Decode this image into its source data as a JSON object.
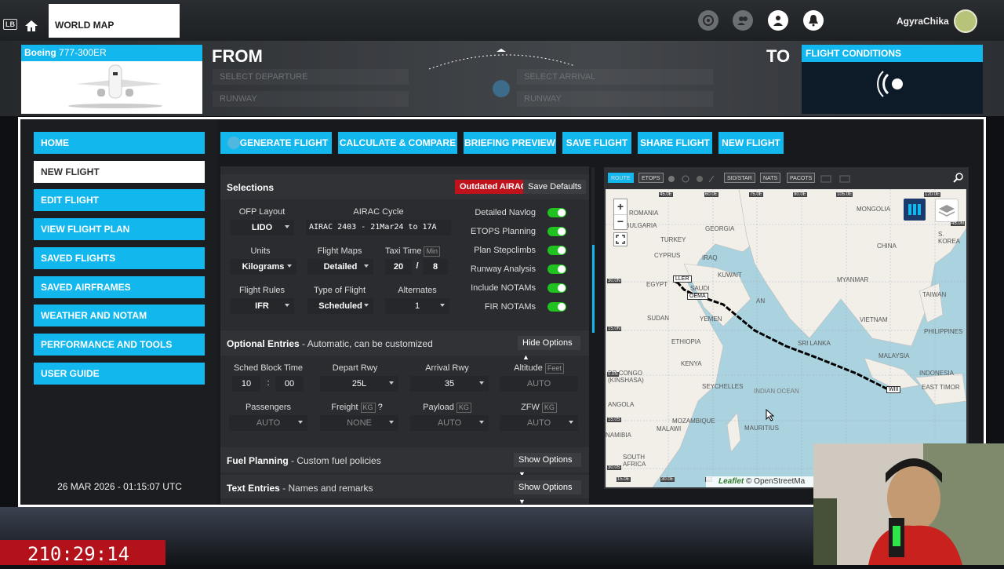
{
  "topbar": {
    "lb_label": "LB",
    "world_map_label": "WORLD MAP",
    "username": "AgyraChika"
  },
  "header": {
    "aircraft_brand": "Boeing",
    "aircraft_model": "777-300ER",
    "from_label": "FROM",
    "to_label": "TO",
    "select_departure": "SELECT DEPARTURE",
    "runway_left": "RUNWAY",
    "select_arrival": "SELECT ARRIVAL",
    "runway_right": "RUNWAY",
    "flight_conditions": "FLIGHT CONDITIONS"
  },
  "sidebar": {
    "items": [
      {
        "label": "HOME"
      },
      {
        "label": "NEW FLIGHT",
        "active": true
      },
      {
        "label": "EDIT FLIGHT"
      },
      {
        "label": "VIEW FLIGHT PLAN"
      },
      {
        "label": "SAVED FLIGHTS"
      },
      {
        "label": "SAVED AIRFRAMES"
      },
      {
        "label": "WEATHER AND NOTAM"
      },
      {
        "label": "PERFORMANCE AND TOOLS"
      },
      {
        "label": "USER GUIDE"
      }
    ],
    "datetime": "26 MAR 2026 - 01:15:07 UTC"
  },
  "actions": {
    "generate": "GENERATE FLIGHT",
    "calculate": "CALCULATE & COMPARE",
    "briefing": "BRIEFING PREVIEW",
    "save": "SAVE FLIGHT",
    "share": "SHARE FLIGHT",
    "new": "NEW FLIGHT"
  },
  "selections": {
    "title": "Selections",
    "outdated_airac": "Outdated AIRAC",
    "save_defaults": "Save Defaults",
    "ofp_layout_label": "OFP Layout",
    "ofp_layout_value": "LIDO",
    "airac_label": "AIRAC Cycle",
    "airac_value": "AIRAC 2403 - 21Mar24 to 17A",
    "units_label": "Units",
    "units_value": "Kilograms",
    "flight_maps_label": "Flight Maps",
    "flight_maps_value": "Detailed",
    "taxi_time_label": "Taxi Time",
    "taxi_unit": "Min",
    "taxi_out": "20",
    "taxi_sep": "/",
    "taxi_in": "8",
    "flight_rules_label": "Flight Rules",
    "flight_rules_value": "IFR",
    "type_label": "Type of Flight",
    "type_value": "Scheduled",
    "alternates_label": "Alternates",
    "alternates_value": "1",
    "toggles": [
      {
        "label": "Detailed Navlog",
        "on": true
      },
      {
        "label": "ETOPS Planning",
        "on": true
      },
      {
        "label": "Plan Stepclimbs",
        "on": true
      },
      {
        "label": "Runway Analysis",
        "on": true
      },
      {
        "label": "Include NOTAMs",
        "on": true
      },
      {
        "label": "FIR NOTAMs",
        "on": true
      }
    ]
  },
  "optional": {
    "title": "Optional Entries",
    "subtitle": " - Automatic, can be customized",
    "hide_options": "Hide Options",
    "sched_block_label": "Sched Block Time",
    "block_h": "10",
    "block_sep": ":",
    "block_m": "00",
    "depart_rwy_label": "Depart Rwy",
    "depart_rwy_value": "25L",
    "arrival_rwy_label": "Arrival Rwy",
    "arrival_rwy_value": "35",
    "altitude_label": "Altitude",
    "altitude_unit": "Feet",
    "altitude_value": "AUTO",
    "passengers_label": "Passengers",
    "passengers_value": "AUTO",
    "freight_label": "Freight",
    "freight_unit": "KG",
    "freight_help": "?",
    "freight_value": "NONE",
    "payload_label": "Payload",
    "payload_unit": "KG",
    "payload_value": "AUTO",
    "zfw_label": "ZFW",
    "zfw_unit": "KG",
    "zfw_value": "AUTO"
  },
  "fuel": {
    "title": "Fuel Planning",
    "subtitle": " - Custom fuel policies",
    "show_options": "Show Options"
  },
  "text_entries": {
    "title": "Text Entries",
    "subtitle": " - Names and remarks",
    "show_options": "Show Options"
  },
  "map": {
    "tabs": [
      "ROUTE",
      "ETOPS",
      "SID/STAR",
      "NATS",
      "PACOTS"
    ],
    "zoom_in": "+",
    "zoom_out": "−",
    "attribution_leaflet": "Leaflet",
    "attribution_osm": "© OpenStreetMa",
    "labels": [
      "ROMANIA",
      "BULGARIA",
      "GEORGIA",
      "TURKEY",
      "CYPRUS",
      "IRAQ",
      "EGYPT",
      "KUWAIT",
      "SAUDI",
      "SUDAN",
      "YEMEN",
      "ETHIOPIA",
      "KENYA",
      "SEYCHELLES",
      "INDIAN OCEAN",
      "MOZAMBIQUE",
      "MAURITIUS",
      "MALAWI",
      "ANGOLA",
      "NAMIBIA",
      "SOUTH AFRICA",
      "MONGOLIA",
      "CHINA",
      "MYANMAR",
      "TAIWAN",
      "VIETNAM",
      "PHILIPPINES",
      "MALAYSIA",
      "INDONESIA",
      "EAST TIMOR",
      "SRI LANKA",
      "S. KOREA",
      "DR CONGO (KINSHASA)",
      "AN"
    ],
    "waypoints": [
      "LLER",
      "OEMA",
      "WIII"
    ],
    "lat_labels": [
      "45.0E",
      "60.0E",
      "75.0E",
      "90.0E",
      "105.0E",
      "120.0E",
      "45.0N",
      "30.0N",
      "15.0N",
      "0.0N",
      "15.0S",
      "30.0S",
      "15.0E",
      "30.0E",
      "45"
    ]
  },
  "overlay": {
    "clock": "210:29:14"
  },
  "colors": {
    "accent": "#12b7ee",
    "outdated": "#c0121b",
    "toggle_on": "#1fc21f",
    "sea": "#aad3df",
    "land": "#f2efe9"
  }
}
